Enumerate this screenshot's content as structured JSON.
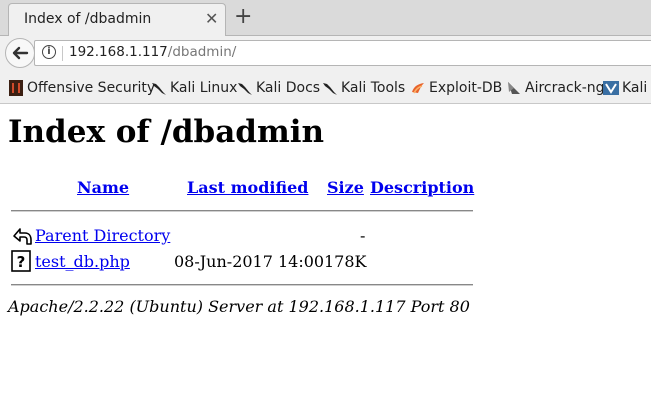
{
  "browser": {
    "tab": {
      "title": "Index of /dbadmin",
      "close_glyph": "✕"
    },
    "new_tab_glyph": "+",
    "address": {
      "host": "192.168.1.117",
      "path": "/dbadmin/"
    },
    "bookmarks": [
      {
        "label": "Offensive Security",
        "icon": "offsec-icon"
      },
      {
        "label": "Kali Linux",
        "icon": "kali-dragon-icon"
      },
      {
        "label": "Kali Docs",
        "icon": "kali-dragon-icon"
      },
      {
        "label": "Kali Tools",
        "icon": "kali-dragon-icon"
      },
      {
        "label": "Exploit-DB",
        "icon": "exploit-db-icon"
      },
      {
        "label": "Aircrack-ng",
        "icon": "aircrack-icon"
      },
      {
        "label": "Kali F",
        "icon": "kali-forums-icon"
      }
    ]
  },
  "page": {
    "heading": "Index of /dbadmin",
    "columns": {
      "name": "Name",
      "last_modified": "Last modified",
      "size": "Size",
      "description": "Description"
    },
    "rows": [
      {
        "name": "Parent Directory",
        "modified": "",
        "size": "-",
        "description": "",
        "icon": "back-folder-icon"
      },
      {
        "name": "test_db.php",
        "modified": "08-Jun-2017 14:00",
        "size": "178K",
        "description": "",
        "icon": "unknown-file-icon"
      }
    ],
    "footer": "Apache/2.2.22 (Ubuntu) Server at 192.168.1.117 Port 80"
  },
  "colors": {
    "link": "#0000ee",
    "chrome": "#f0f0f0",
    "tabstrip": "#dadada"
  }
}
